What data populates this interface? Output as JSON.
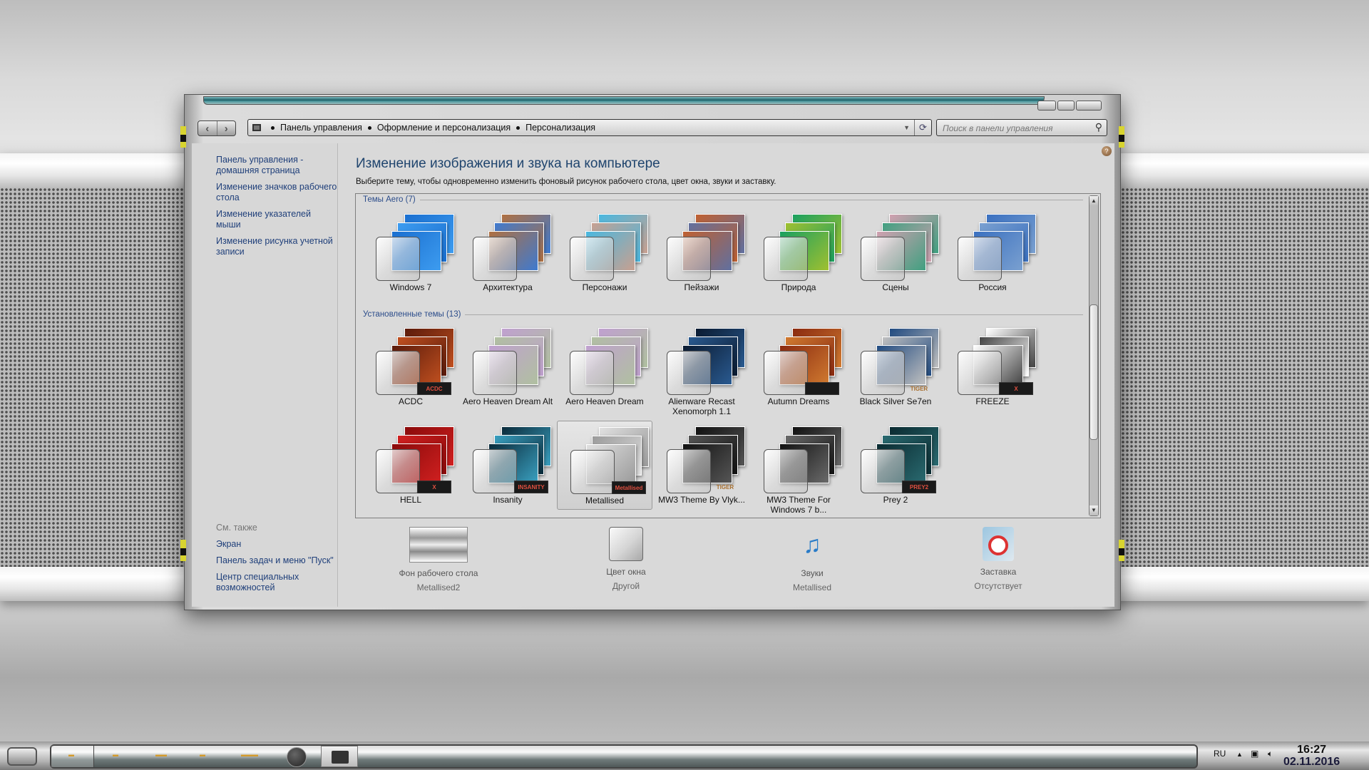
{
  "window": {
    "breadcrumb": [
      "Панель управления",
      "Оформление и персонализация",
      "Персонализация"
    ],
    "search_placeholder": "Поиск в панели управления",
    "nav": {
      "back": "‹",
      "forward": "›"
    }
  },
  "sidebar": {
    "links": [
      "Панель управления - домашняя страница",
      "Изменение значков рабочего стола",
      "Изменение указателей мыши",
      "Изменение рисунка учетной записи"
    ],
    "see_also_label": "См. также",
    "see_also": [
      "Экран",
      "Панель задач и меню \"Пуск\"",
      "Центр специальных возможностей"
    ]
  },
  "main": {
    "title": "Изменение изображения и звука на компьютере",
    "subtitle": "Выберите тему, чтобы одновременно изменить фоновый рисунок рабочего стола, цвет окна, звуки и заставку.",
    "groups": [
      {
        "label": "Темы Aero (7)",
        "themes": [
          {
            "name": "Windows 7",
            "colors": [
              "#1a6fd0",
              "#3d9cf0"
            ]
          },
          {
            "name": "Архитектура",
            "colors": [
              "#b07040",
              "#3e7ad0"
            ]
          },
          {
            "name": "Персонажи",
            "colors": [
              "#48b8e0",
              "#c8a090"
            ]
          },
          {
            "name": "Пейзажи",
            "colors": [
              "#c06030",
              "#6070a0"
            ]
          },
          {
            "name": "Природа",
            "colors": [
              "#1aa060",
              "#a0c030"
            ]
          },
          {
            "name": "Сцены",
            "colors": [
              "#d0a0b0",
              "#40a080"
            ]
          },
          {
            "name": "Россия",
            "colors": [
              "#3a70c0",
              "#7aa0d0"
            ]
          }
        ]
      },
      {
        "label": "Установленные темы (13)",
        "themes": [
          {
            "name": "ACDC",
            "colors": [
              "#5a1a0a",
              "#c05020"
            ],
            "badge": "ACDC"
          },
          {
            "name": "Aero Heaven Dream Alt",
            "colors": [
              "#c0a0d0",
              "#b0c0a0"
            ]
          },
          {
            "name": "Aero Heaven Dream",
            "colors": [
              "#c0a0d0",
              "#b0c0a0"
            ]
          },
          {
            "name": "Alienware Recast Xenomorph 1.1",
            "colors": [
              "#0a1a30",
              "#2a5a90"
            ]
          },
          {
            "name": "Autumn Dreams",
            "colors": [
              "#8a2a10",
              "#d07a30"
            ],
            "badge": ""
          },
          {
            "name": "Black Silver Se7en",
            "colors": [
              "#204a80",
              "#c0c0c0"
            ],
            "badge": "TIGER"
          },
          {
            "name": "FREEZE",
            "colors": [
              "#ffffff",
              "#444444"
            ],
            "badge": "X"
          },
          {
            "name": "HELL",
            "colors": [
              "#8a0a0a",
              "#d02020"
            ],
            "badge": "X"
          },
          {
            "name": "Insanity",
            "colors": [
              "#0a2a3a",
              "#3aa0c0"
            ],
            "badge": "INSANITY"
          },
          {
            "name": "Metallised",
            "colors": [
              "#e0e0e0",
              "#9a9a9a"
            ],
            "badge": "Metallised",
            "selected": true
          },
          {
            "name": "MW3 Theme By Vlyk...",
            "colors": [
              "#111111",
              "#555555"
            ],
            "badge": "TIGER"
          },
          {
            "name": "MW3 Theme For Windows 7 b...",
            "colors": [
              "#111111",
              "#6a6a6a"
            ]
          },
          {
            "name": "Prey 2",
            "colors": [
              "#0a2a30",
              "#2a6a70"
            ],
            "badge": "PREY2"
          }
        ]
      }
    ],
    "bottom": [
      {
        "label": "Фон рабочего стола",
        "value": "Metallised2",
        "icon": "wallpaper-icon"
      },
      {
        "label": "Цвет окна",
        "value": "Другой",
        "icon": "window-color-icon"
      },
      {
        "label": "Звуки",
        "value": "Metallised",
        "icon": "sounds-icon"
      },
      {
        "label": "Заставка",
        "value": "Отсутствует",
        "icon": "screensaver-icon"
      }
    ]
  },
  "taskbar": {
    "language": "RU",
    "time": "16:27",
    "date": "02.11.2016"
  }
}
